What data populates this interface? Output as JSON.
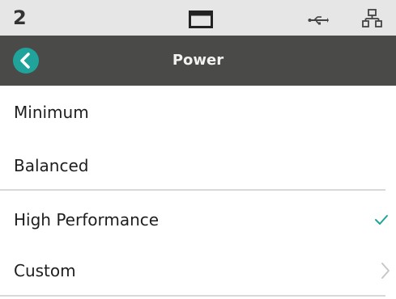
{
  "status_bar": {
    "number": "2",
    "icons": [
      "window-icon",
      "usb-icon",
      "network-icon"
    ]
  },
  "header": {
    "title": "Power",
    "back_icon": "chevron-left-icon"
  },
  "options": [
    {
      "label": "Minimum",
      "selected": false
    },
    {
      "label": "Balanced",
      "selected": false
    },
    {
      "label": "High Performance",
      "selected": true,
      "indicator": "check-icon"
    },
    {
      "label": "Custom",
      "selected": false,
      "indicator": "chevron-right-icon"
    }
  ],
  "colors": {
    "accent": "#20a39a",
    "header_bg": "#4a4a48",
    "status_bg": "#e6e6e6",
    "check": "#20a39a"
  }
}
